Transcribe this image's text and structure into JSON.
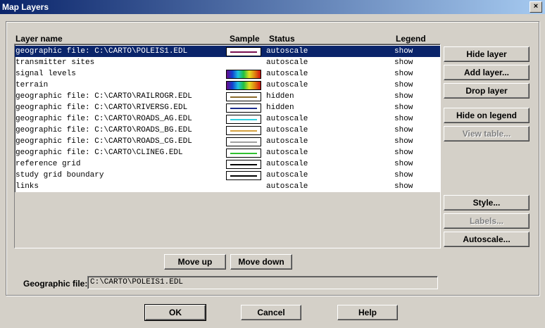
{
  "window": {
    "title": "Map Layers",
    "close_glyph": "×"
  },
  "columns": {
    "name": "Layer name",
    "sample": "Sample",
    "status": "Status",
    "legend": "Legend"
  },
  "layers": [
    {
      "name": "geographic file: C:\\CARTO\\POLEIS1.EDL",
      "status": "autoscale",
      "legend": "show",
      "sample": "line",
      "color": "#7a1050",
      "selected": true
    },
    {
      "name": "transmitter sites",
      "status": "autoscale",
      "legend": "show",
      "sample": "none"
    },
    {
      "name": "signal levels",
      "status": "autoscale",
      "legend": "show",
      "sample": "gradient"
    },
    {
      "name": "terrain",
      "status": "autoscale",
      "legend": "show",
      "sample": "gradient"
    },
    {
      "name": "geographic file: C:\\CARTO\\RAILROGR.EDL",
      "status": "hidden",
      "legend": "show",
      "sample": "line",
      "color": "#8b6a2a"
    },
    {
      "name": "geographic file: C:\\CARTO\\RIVERSG.EDL",
      "status": "hidden",
      "legend": "show",
      "sample": "line",
      "color": "#1a2a8a"
    },
    {
      "name": "geographic file: C:\\CARTO\\ROADS_AG.EDL",
      "status": "autoscale",
      "legend": "show",
      "sample": "line",
      "color": "#30d0e0"
    },
    {
      "name": "geographic file: C:\\CARTO\\ROADS_BG.EDL",
      "status": "autoscale",
      "legend": "show",
      "sample": "line",
      "color": "#d4a040"
    },
    {
      "name": "geographic file: C:\\CARTO\\ROADS_CG.EDL",
      "status": "autoscale",
      "legend": "show",
      "sample": "line",
      "color": "#a0a0a0"
    },
    {
      "name": "geographic file: C:\\CARTO\\CLINEG.EDL",
      "status": "autoscale",
      "legend": "show",
      "sample": "line",
      "color": "#30c030"
    },
    {
      "name": "reference grid",
      "status": "autoscale",
      "legend": "show",
      "sample": "line",
      "color": "#000000"
    },
    {
      "name": "study grid boundary",
      "status": "autoscale",
      "legend": "show",
      "sample": "line",
      "color": "#000000"
    },
    {
      "name": "links",
      "status": "autoscale",
      "legend": "show",
      "sample": "none"
    }
  ],
  "side_buttons": {
    "hide_layer": "Hide layer",
    "add_layer": "Add layer...",
    "drop_layer": "Drop layer",
    "hide_on_legend": "Hide on legend",
    "view_table": "View table...",
    "style": "Style...",
    "labels": "Labels...",
    "autoscale": "Autoscale..."
  },
  "move_buttons": {
    "up": "Move up",
    "down": "Move down"
  },
  "geographic": {
    "label": "Geographic file:",
    "value": "C:\\CARTO\\POLEIS1.EDL"
  },
  "bottom_buttons": {
    "ok": "OK",
    "cancel": "Cancel",
    "help": "Help"
  }
}
